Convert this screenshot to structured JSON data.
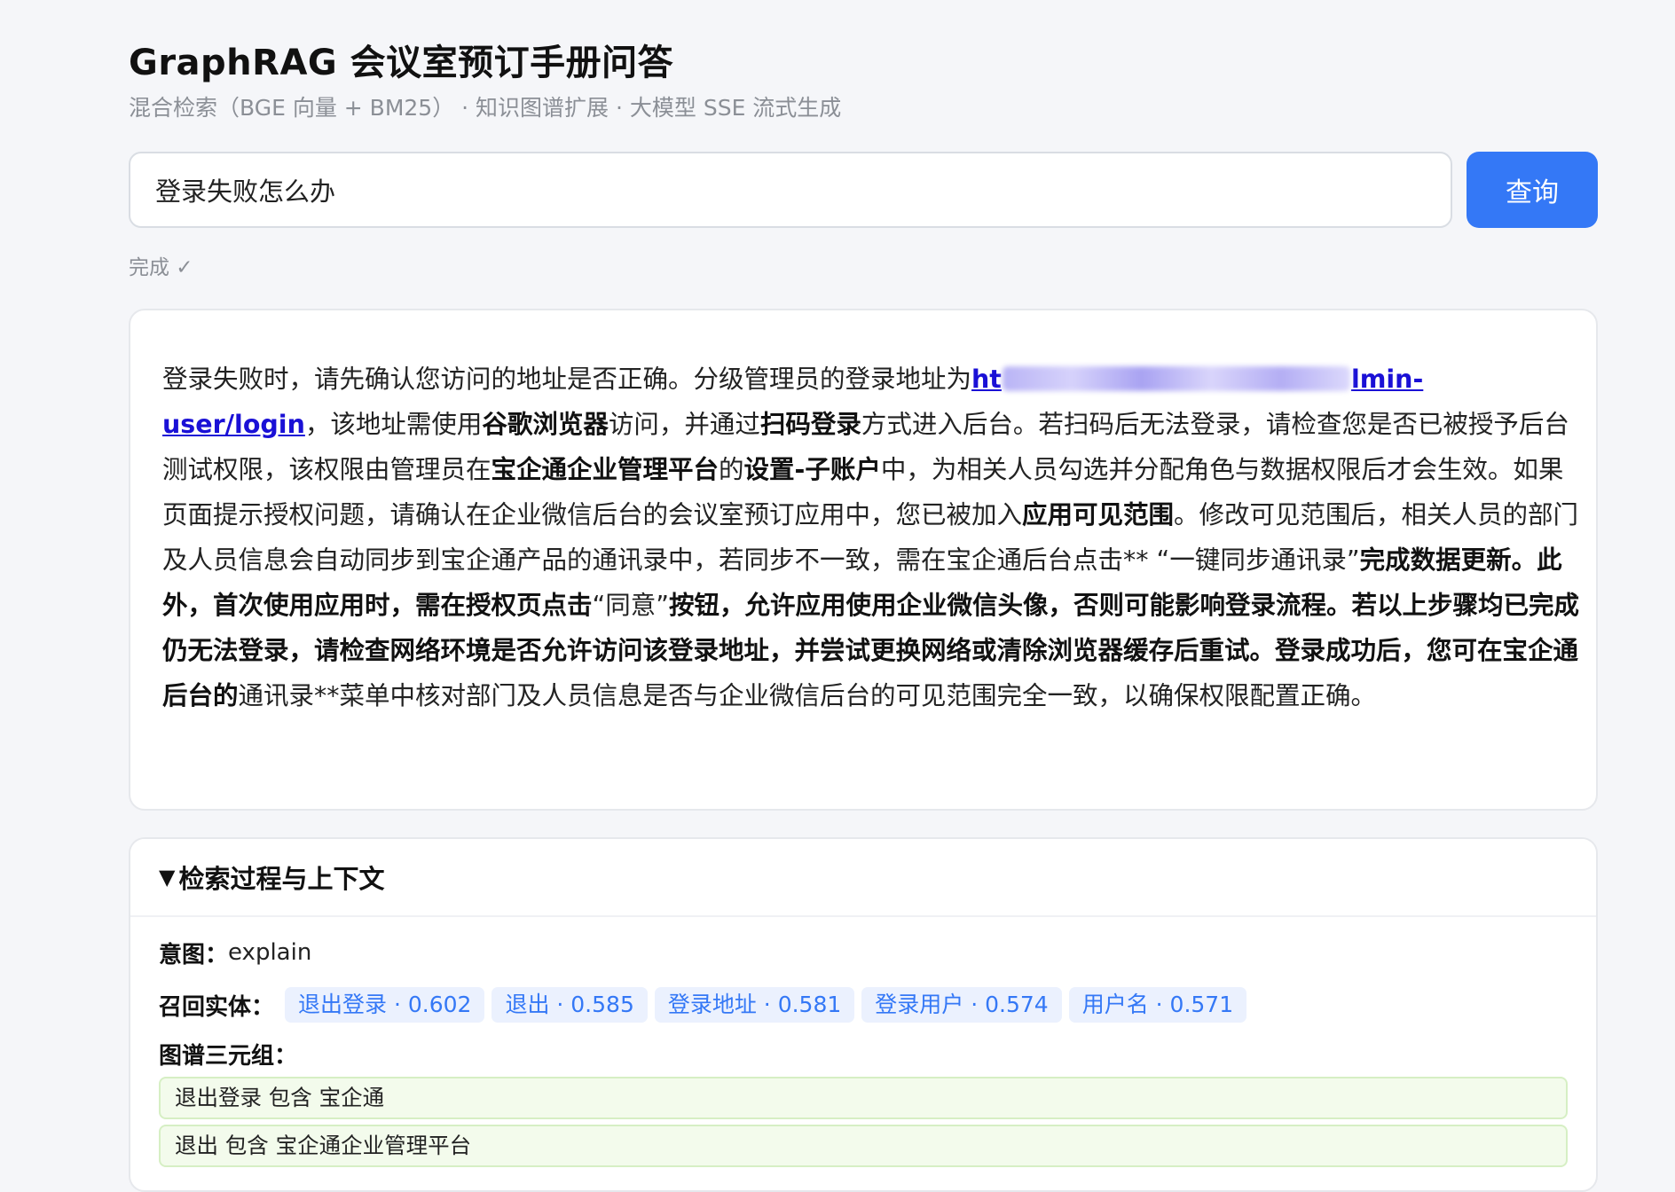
{
  "header": {
    "title": "GraphRAG 会议室预订手册问答",
    "subtitle": "混合检索（BGE 向量 + BM25） · 知识图谱扩展 · 大模型 SSE 流式生成"
  },
  "search": {
    "value": "登录失败怎么办",
    "button_label": "查询"
  },
  "status_text": "完成 ✓",
  "answer": {
    "seg01": "登录失败时，请先确认您访问的地址是否正确。分级管理员的登录地址为",
    "link_start": "ht",
    "link_end": "lmin-user/login",
    "seg02": "，该地址需使用",
    "b01": "谷歌浏览器",
    "seg03": "访问，并通过",
    "b02": "扫码登录",
    "seg04": "方式进入后台。若扫码后无法登录，请检查您是否已被授予后台测试权限，该权限由管理员在",
    "b03": "宝企通企业管理平台",
    "seg05": "的",
    "b04": "设置-子账户",
    "seg06": "中，为相关人员勾选并分配角色与数据权限后才会生效。如果页面提示授权问题，请确认在企业微信后台的会议室预订应用中，您已被加入",
    "b05": "应用可见范围",
    "seg07": "。修改可见范围后，相关人员的部门及人员信息会自动同步到宝企通产品的通讯录中，若同步不一致，需在宝企通后台点击** “一键同步通讯录”",
    "b06": "完成数据更新。此外，首次使用应用时，需在授权页点击",
    "seg08": "“同意”",
    "b07": "按钮，允许应用使用企业微信头像，否则可能影响登录流程。若以上步骤均已完成仍无法登录，请检查网络环境是否允许访问该登录地址，并尝试更换网络或清除浏览器缓存后重试。登录成功后，您可在宝企通后台的",
    "seg09": "通讯录**菜单中核对部门及人员信息是否与企业微信后台的可见范围完全一致，以确保权限配置正确。"
  },
  "retrieval": {
    "summary_label": "检索过程与上下文",
    "intent_label": "意图：",
    "intent_value": "explain",
    "entities_label": "召回实体：",
    "entities": [
      {
        "text": "退出登录 · 0.602"
      },
      {
        "text": "退出 · 0.585"
      },
      {
        "text": "登录地址 · 0.581"
      },
      {
        "text": "登录用户 · 0.574"
      },
      {
        "text": "用户名 · 0.571"
      }
    ],
    "triples_label": "图谱三元组：",
    "triples": [
      {
        "text": "退出登录 包含 宝企通"
      },
      {
        "text": "退出 包含 宝企通企业管理平台"
      }
    ]
  },
  "colors": {
    "accent": "#3478f6",
    "link": "#1a10d6",
    "chip_bg": "#ebf1fe",
    "triple_bg": "#f3fbec",
    "triple_border": "#d6efc4"
  }
}
